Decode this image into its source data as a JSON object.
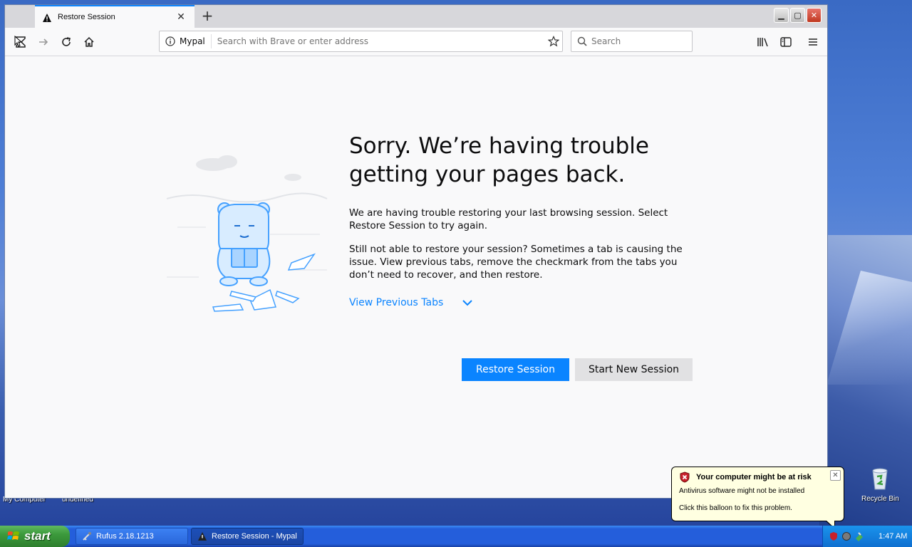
{
  "browser": {
    "tab_title": "Restore Session",
    "identity_label": "Mypal",
    "url_placeholder": "Search with Brave or enter address",
    "search_placeholder": "Search"
  },
  "page": {
    "headline_line1": "Sorry. We’re having trouble",
    "headline_line2": "getting your pages back.",
    "para1": "We are having trouble restoring your last browsing session. Select Restore Session to try again.",
    "para2": "Still not able to restore your session? Sometimes a tab is causing the issue. View previous tabs, remove the checkmark from the tabs you don’t need to recover, and then restore.",
    "view_previous": "View Previous Tabs",
    "restore_button": "Restore Session",
    "new_session_button": "Start New Session"
  },
  "desktop": {
    "recycle_bin": "Recycle Bin",
    "icon_label_1": "My Computer",
    "icon_label_2": "undefined"
  },
  "balloon": {
    "title": "Your computer might be at risk",
    "line1": "Antivirus software might not be installed",
    "line2": "Click this balloon to fix this problem."
  },
  "taskbar": {
    "start_label": "start",
    "items": [
      {
        "label": "Rufus 2.18.1213"
      },
      {
        "label": "Restore Session - Mypal"
      }
    ],
    "clock": "1:47 AM"
  },
  "colors": {
    "accent": "#0a84ff",
    "illustration": "#45a1ff"
  }
}
